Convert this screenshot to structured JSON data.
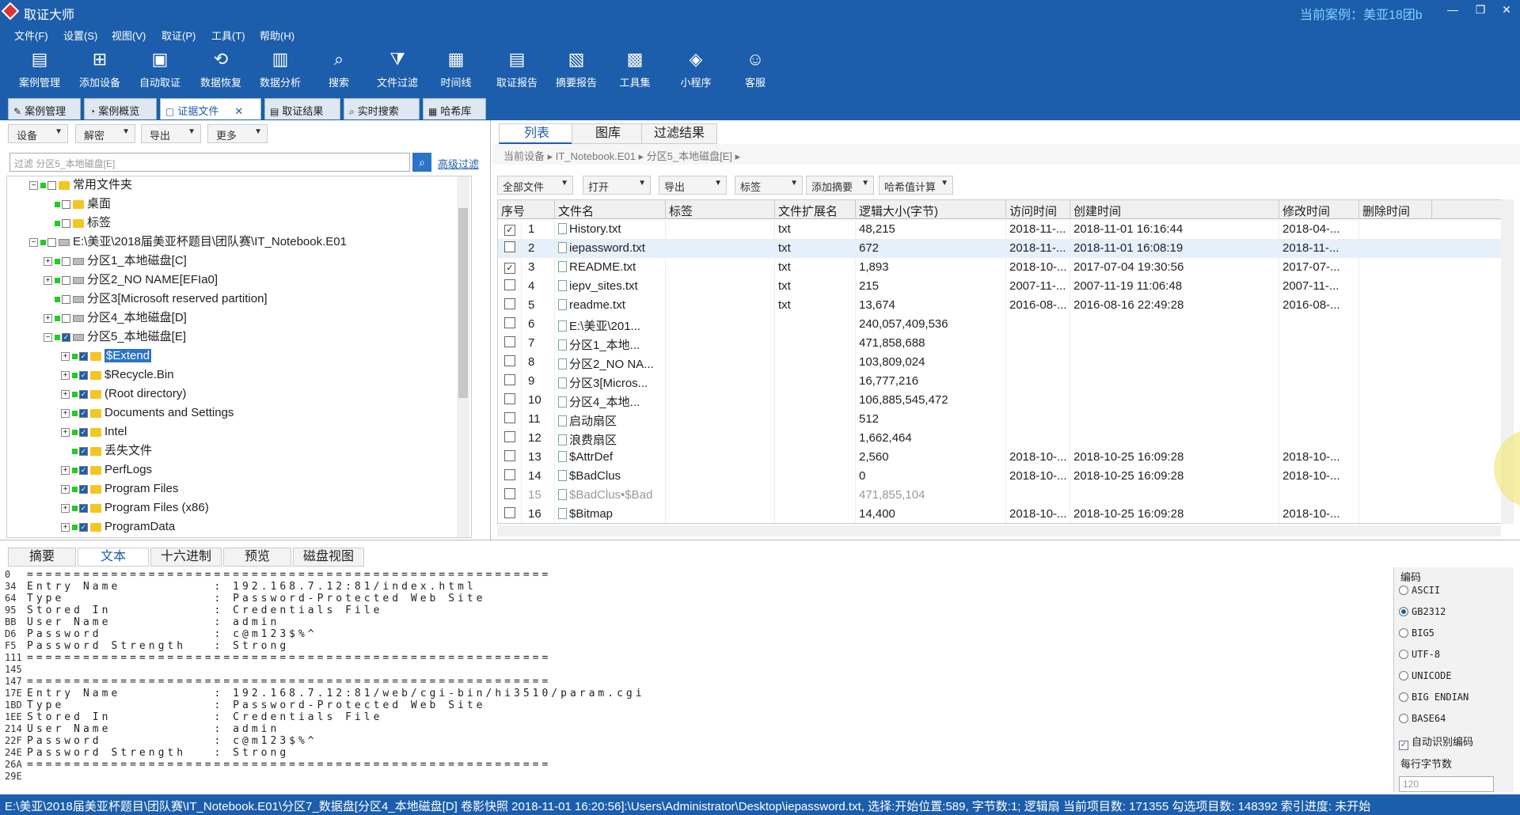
{
  "app": {
    "title": "取证大师",
    "case_label": "当前案例：美亚18团b",
    "win_min": "—",
    "win_max": "❐",
    "win_close": "✕"
  },
  "menu": [
    "文件(F)",
    "设置(S)",
    "视图(V)",
    "取证(P)",
    "工具(T)",
    "帮助(H)"
  ],
  "toolbar": [
    {
      "label": "案例管理",
      "icon": "folder-icon",
      "glyph": "▤"
    },
    {
      "label": "添加设备",
      "icon": "add-device-icon",
      "glyph": "⊞"
    },
    {
      "label": "自动取证",
      "icon": "auto-icon",
      "glyph": "▣"
    },
    {
      "label": "数据恢复",
      "icon": "recover-icon",
      "glyph": "⟲"
    },
    {
      "label": "数据分析",
      "icon": "analysis-icon",
      "glyph": "▥"
    },
    {
      "label": "搜索",
      "icon": "search-icon",
      "glyph": "⌕"
    },
    {
      "label": "文件过滤",
      "icon": "filter-icon",
      "glyph": "⧩"
    },
    {
      "label": "时间线",
      "icon": "timeline-icon",
      "glyph": "▦"
    },
    {
      "label": "取证报告",
      "icon": "report-icon",
      "glyph": "▤"
    },
    {
      "label": "摘要报告",
      "icon": "summary-icon",
      "glyph": "▧"
    },
    {
      "label": "工具集",
      "icon": "tools-icon",
      "glyph": "▩"
    },
    {
      "label": "小程序",
      "icon": "miniapp-icon",
      "glyph": "◈"
    },
    {
      "label": "客服",
      "icon": "service-icon",
      "glyph": "☺"
    }
  ],
  "tabs": [
    {
      "label": "案例管理",
      "glyph": "✎"
    },
    {
      "label": "案例概览",
      "glyph": "◔"
    },
    {
      "label": "证据文件",
      "glyph": "▢",
      "close": "✕"
    },
    {
      "label": "取证结果",
      "glyph": "▤"
    },
    {
      "label": "实时搜索",
      "glyph": "⌕"
    },
    {
      "label": "哈希库",
      "glyph": "▦"
    }
  ],
  "left": {
    "dropdowns": [
      "设备",
      "解密",
      "导出",
      "更多"
    ],
    "filter_placeholder": "过滤 分区5_本地磁盘[E]",
    "adv_filter": "高级过滤",
    "tree": [
      "常用文件夹",
      "桌面",
      "标签",
      "E:\\美亚\\2018届美亚杯题目\\团队赛\\IT_Notebook.E01",
      "分区1_本地磁盘[C]",
      "分区2_NO NAME[EFIa0]",
      "分区3[Microsoft reserved partition]",
      "分区4_本地磁盘[D]",
      "分区5_本地磁盘[E]",
      "$Extend",
      "$Recycle.Bin",
      "(Root directory)",
      "Documents and Settings",
      "Intel",
      "丢失文件",
      "PerfLogs",
      "Program Files",
      "Program Files (x86)",
      "ProgramData"
    ]
  },
  "right": {
    "tabs": [
      "列表",
      "图库",
      "过滤结果"
    ],
    "breadcrumb": "当前设备 ▸ IT_Notebook.E01 ▸ 分区5_本地磁盘[E] ▸",
    "dropdowns": [
      "全部文件",
      "打开",
      "导出",
      "标签",
      "添加摘要",
      "哈希值计算"
    ],
    "columns": [
      "序号",
      "文件名",
      "标签",
      "文件扩展名",
      "逻辑大小(字节)",
      "访问时间",
      "创建时间",
      "修改时间",
      "删除时间"
    ],
    "rows": [
      {
        "chk": "✓",
        "n": "1",
        "name": "History.txt",
        "ext": "txt",
        "size": "48,215",
        "acc": "2018-11-...",
        "cre": "2018-11-01 16:16:44",
        "mod": "2018-04-..."
      },
      {
        "chk": "",
        "n": "2",
        "name": "iepassword.txt",
        "ext": "txt",
        "size": "672",
        "acc": "2018-11-...",
        "cre": "2018-11-01 16:08:19",
        "mod": "2018-11-..."
      },
      {
        "chk": "✓",
        "n": "3",
        "name": "README.txt",
        "ext": "txt",
        "size": "1,893",
        "acc": "2018-10-...",
        "cre": "2017-07-04 19:30:56",
        "mod": "2017-07-..."
      },
      {
        "chk": "",
        "n": "4",
        "name": "iepv_sites.txt",
        "ext": "txt",
        "size": "215",
        "acc": "2007-11-...",
        "cre": "2007-11-19 11:06:48",
        "mod": "2007-11-..."
      },
      {
        "chk": "",
        "n": "5",
        "name": "readme.txt",
        "ext": "txt",
        "size": "13,674",
        "acc": "2016-08-...",
        "cre": "2016-08-16 22:49:28",
        "mod": "2016-08-..."
      },
      {
        "chk": "",
        "n": "6",
        "name": "E:\\美亚\\201...",
        "ext": "",
        "size": "240,057,409,536",
        "acc": "",
        "cre": "",
        "mod": ""
      },
      {
        "chk": "",
        "n": "7",
        "name": "分区1_本地...",
        "ext": "",
        "size": "471,858,688",
        "acc": "",
        "cre": "",
        "mod": ""
      },
      {
        "chk": "",
        "n": "8",
        "name": "分区2_NO NA...",
        "ext": "",
        "size": "103,809,024",
        "acc": "",
        "cre": "",
        "mod": ""
      },
      {
        "chk": "",
        "n": "9",
        "name": "分区3[Micros...",
        "ext": "",
        "size": "16,777,216",
        "acc": "",
        "cre": "",
        "mod": ""
      },
      {
        "chk": "",
        "n": "10",
        "name": "分区4_本地...",
        "ext": "",
        "size": "106,885,545,472",
        "acc": "",
        "cre": "",
        "mod": ""
      },
      {
        "chk": "",
        "n": "11",
        "name": "启动扇区",
        "ext": "",
        "size": "512",
        "acc": "",
        "cre": "",
        "mod": ""
      },
      {
        "chk": "",
        "n": "12",
        "name": "浪费扇区",
        "ext": "",
        "size": "1,662,464",
        "acc": "",
        "cre": "",
        "mod": ""
      },
      {
        "chk": "",
        "n": "13",
        "name": "$AttrDef",
        "ext": "",
        "size": "2,560",
        "acc": "2018-10-...",
        "cre": "2018-10-25 16:09:28",
        "mod": "2018-10-..."
      },
      {
        "chk": "",
        "n": "14",
        "name": "$BadClus",
        "ext": "",
        "size": "0",
        "acc": "2018-10-...",
        "cre": "2018-10-25 16:09:28",
        "mod": "2018-10-..."
      },
      {
        "chk": "",
        "n": "15",
        "name": "$BadClus•$Bad",
        "ext": "",
        "size": "471,855,104",
        "acc": "",
        "cre": "",
        "mod": ""
      },
      {
        "chk": "",
        "n": "16",
        "name": "$Bitmap",
        "ext": "",
        "size": "14,400",
        "acc": "2018-10-...",
        "cre": "2018-10-25 16:09:28",
        "mod": "2018-10-..."
      }
    ]
  },
  "bottom": {
    "tabs": [
      "摘要",
      "文本",
      "十六进制",
      "预览",
      "磁盘视图"
    ],
    "lines": [
      {
        "off": "0",
        "text": "========================================================"
      },
      {
        "off": "34",
        "text": "Entry Name          : 192.168.7.12:81/index.html"
      },
      {
        "off": "64",
        "text": "Type                : Password-Protected Web Site"
      },
      {
        "off": "95",
        "text": "Stored In           : Credentials File"
      },
      {
        "off": "BB",
        "text": "User Name           : admin"
      },
      {
        "off": "D6",
        "text": "Password            : c@m123$%^"
      },
      {
        "off": "F5",
        "text": "Password Strength   : Strong"
      },
      {
        "off": "111",
        "text": "========================================================"
      },
      {
        "off": "145",
        "text": ""
      },
      {
        "off": "147",
        "text": "========================================================"
      },
      {
        "off": "17E",
        "text": "Entry Name          : 192.168.7.12:81/web/cgi-bin/hi3510/param.cgi"
      },
      {
        "off": "1BD",
        "text": "Type                : Password-Protected Web Site"
      },
      {
        "off": "1EE",
        "text": "Stored In           : Credentials File"
      },
      {
        "off": "214",
        "text": "User Name           : admin"
      },
      {
        "off": "22F",
        "text": "Password            : c@m123$%^"
      },
      {
        "off": "24E",
        "text": "Password Strength   : Strong"
      },
      {
        "off": "26A",
        "text": "========================================================"
      },
      {
        "off": "29E",
        "text": ""
      }
    ],
    "encoding_title": "编码",
    "encodings": [
      "ASCII",
      "GB2312",
      "BIG5",
      "UTF-8",
      "UNICODE",
      "BIG ENDIAN",
      "BASE64"
    ],
    "encoding_selected": "GB2312",
    "auto_detect": "自动识别编码",
    "bytes_per_line": "每行字节数",
    "bytes_value": "120"
  },
  "status": "E:\\美亚\\2018届美亚杯题目\\团队赛\\IT_Notebook.E01\\分区7_数据盘[分区4_本地磁盘[D] 卷影快照 2018-11-01 16:20:56]:\\Users\\Administrator\\Desktop\\iepassword.txt, 选择:开始位置:589, 字节数:1; 逻辑扇 当前项目数: 171355   勾选项目数: 148392   索引进度: 未开始"
}
